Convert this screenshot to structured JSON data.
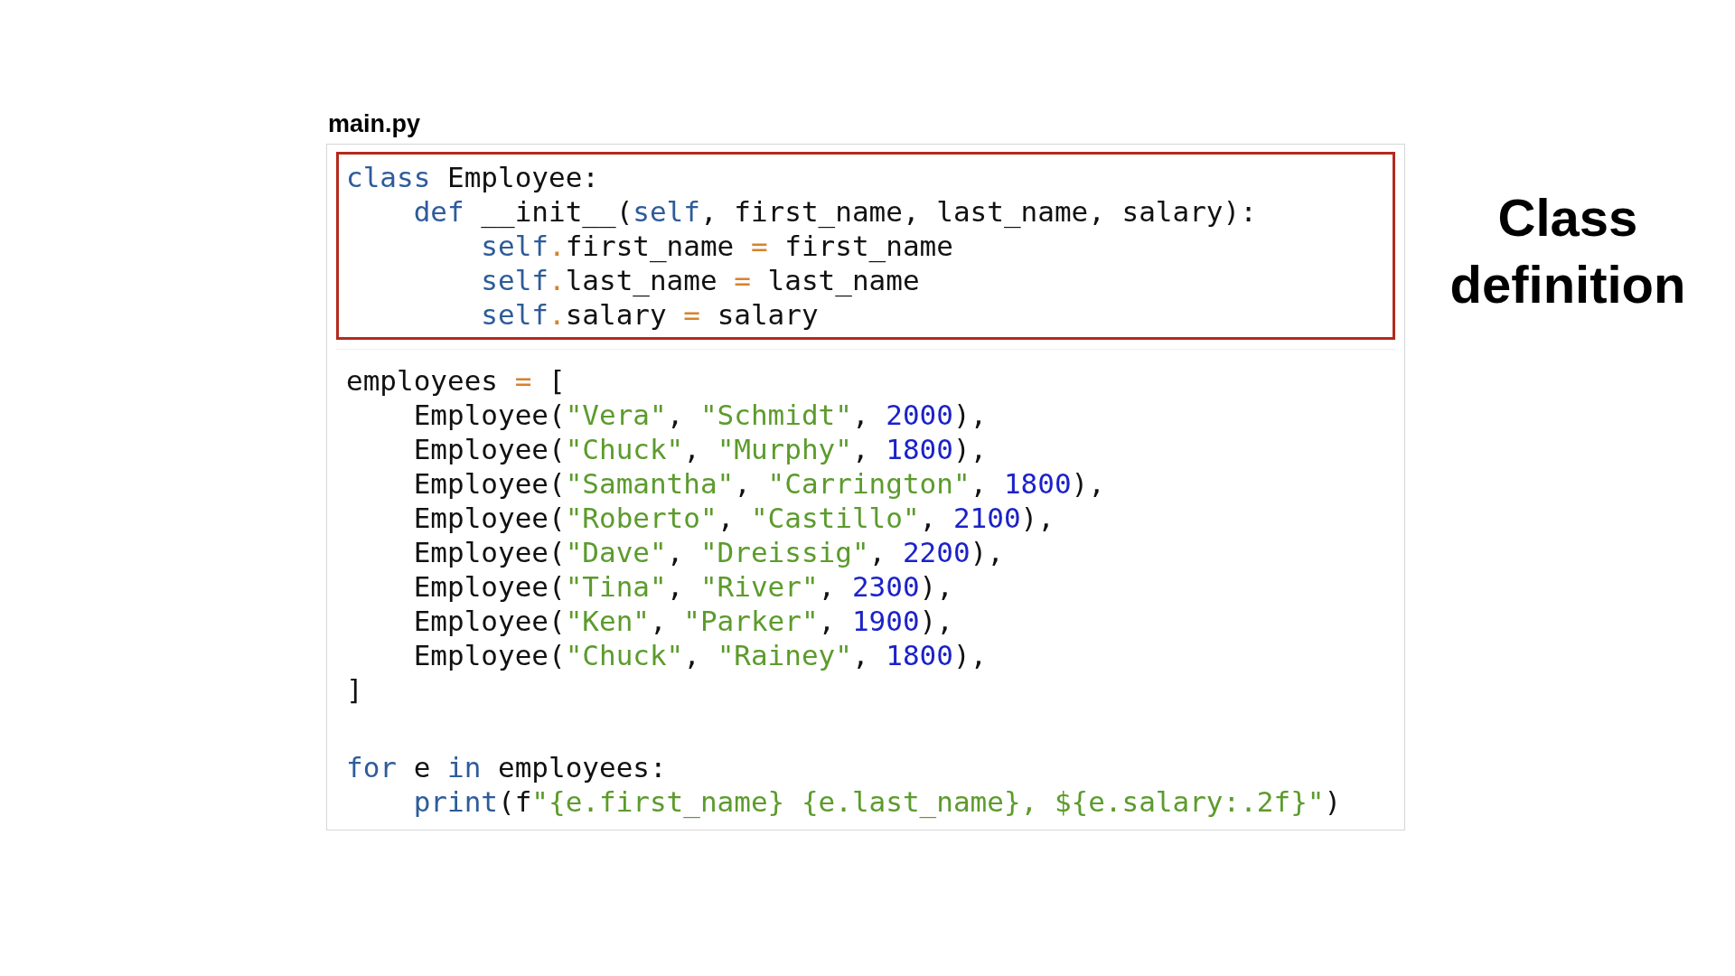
{
  "file": {
    "name": "main.py"
  },
  "code_blocks": [
    {
      "kind": "highlighted",
      "lines": [
        {
          "tokens": [
            {
              "kind": "keyword",
              "text": "class"
            },
            {
              "kind": "plain",
              "text": " Employee:"
            }
          ]
        },
        {
          "tokens": [
            {
              "kind": "keyword",
              "text": "    def"
            },
            {
              "kind": "plain",
              "text": " __init__("
            },
            {
              "kind": "keyword",
              "text": "self"
            },
            {
              "kind": "plain",
              "text": ", first_name, last_name, salary):"
            }
          ]
        },
        {
          "tokens": [
            {
              "kind": "keyword",
              "text": "        self"
            },
            {
              "kind": "operator",
              "text": "."
            },
            {
              "kind": "plain",
              "text": "first_name "
            },
            {
              "kind": "operator",
              "text": "="
            },
            {
              "kind": "plain",
              "text": " first_name"
            }
          ]
        },
        {
          "tokens": [
            {
              "kind": "keyword",
              "text": "        self"
            },
            {
              "kind": "operator",
              "text": "."
            },
            {
              "kind": "plain",
              "text": "last_name "
            },
            {
              "kind": "operator",
              "text": "="
            },
            {
              "kind": "plain",
              "text": " last_name"
            }
          ]
        },
        {
          "tokens": [
            {
              "kind": "keyword",
              "text": "        self"
            },
            {
              "kind": "operator",
              "text": "."
            },
            {
              "kind": "plain",
              "text": "salary "
            },
            {
              "kind": "operator",
              "text": "="
            },
            {
              "kind": "plain",
              "text": " salary"
            }
          ]
        }
      ]
    },
    {
      "kind": "plain",
      "lines": [
        {
          "tokens": [
            {
              "kind": "plain",
              "text": "employees "
            },
            {
              "kind": "operator",
              "text": "="
            },
            {
              "kind": "plain",
              "text": " ["
            }
          ]
        },
        {
          "tokens": [
            {
              "kind": "plain",
              "text": "    Employee("
            },
            {
              "kind": "string",
              "text": "\"Vera\""
            },
            {
              "kind": "plain",
              "text": ", "
            },
            {
              "kind": "string",
              "text": "\"Schmidt\""
            },
            {
              "kind": "plain",
              "text": ", "
            },
            {
              "kind": "number",
              "text": "2000"
            },
            {
              "kind": "plain",
              "text": "),"
            }
          ]
        },
        {
          "tokens": [
            {
              "kind": "plain",
              "text": "    Employee("
            },
            {
              "kind": "string",
              "text": "\"Chuck\""
            },
            {
              "kind": "plain",
              "text": ", "
            },
            {
              "kind": "string",
              "text": "\"Murphy\""
            },
            {
              "kind": "plain",
              "text": ", "
            },
            {
              "kind": "number",
              "text": "1800"
            },
            {
              "kind": "plain",
              "text": "),"
            }
          ]
        },
        {
          "tokens": [
            {
              "kind": "plain",
              "text": "    Employee("
            },
            {
              "kind": "string",
              "text": "\"Samantha\""
            },
            {
              "kind": "plain",
              "text": ", "
            },
            {
              "kind": "string",
              "text": "\"Carrington\""
            },
            {
              "kind": "plain",
              "text": ", "
            },
            {
              "kind": "number",
              "text": "1800"
            },
            {
              "kind": "plain",
              "text": "),"
            }
          ]
        },
        {
          "tokens": [
            {
              "kind": "plain",
              "text": "    Employee("
            },
            {
              "kind": "string",
              "text": "\"Roberto\""
            },
            {
              "kind": "plain",
              "text": ", "
            },
            {
              "kind": "string",
              "text": "\"Castillo\""
            },
            {
              "kind": "plain",
              "text": ", "
            },
            {
              "kind": "number",
              "text": "2100"
            },
            {
              "kind": "plain",
              "text": "),"
            }
          ]
        },
        {
          "tokens": [
            {
              "kind": "plain",
              "text": "    Employee("
            },
            {
              "kind": "string",
              "text": "\"Dave\""
            },
            {
              "kind": "plain",
              "text": ", "
            },
            {
              "kind": "string",
              "text": "\"Dreissig\""
            },
            {
              "kind": "plain",
              "text": ", "
            },
            {
              "kind": "number",
              "text": "2200"
            },
            {
              "kind": "plain",
              "text": "),"
            }
          ]
        },
        {
          "tokens": [
            {
              "kind": "plain",
              "text": "    Employee("
            },
            {
              "kind": "string",
              "text": "\"Tina\""
            },
            {
              "kind": "plain",
              "text": ", "
            },
            {
              "kind": "string",
              "text": "\"River\""
            },
            {
              "kind": "plain",
              "text": ", "
            },
            {
              "kind": "number",
              "text": "2300"
            },
            {
              "kind": "plain",
              "text": "),"
            }
          ]
        },
        {
          "tokens": [
            {
              "kind": "plain",
              "text": "    Employee("
            },
            {
              "kind": "string",
              "text": "\"Ken\""
            },
            {
              "kind": "plain",
              "text": ", "
            },
            {
              "kind": "string",
              "text": "\"Parker\""
            },
            {
              "kind": "plain",
              "text": ", "
            },
            {
              "kind": "number",
              "text": "1900"
            },
            {
              "kind": "plain",
              "text": "),"
            }
          ]
        },
        {
          "tokens": [
            {
              "kind": "plain",
              "text": "    Employee("
            },
            {
              "kind": "string",
              "text": "\"Chuck\""
            },
            {
              "kind": "plain",
              "text": ", "
            },
            {
              "kind": "string",
              "text": "\"Rainey\""
            },
            {
              "kind": "plain",
              "text": ", "
            },
            {
              "kind": "number",
              "text": "1800"
            },
            {
              "kind": "plain",
              "text": "),"
            }
          ]
        },
        {
          "tokens": [
            {
              "kind": "plain",
              "text": "]"
            }
          ]
        }
      ]
    },
    {
      "kind": "plain",
      "lines": [
        {
          "tokens": [
            {
              "kind": "keyword",
              "text": "for"
            },
            {
              "kind": "plain",
              "text": " e "
            },
            {
              "kind": "keyword",
              "text": "in"
            },
            {
              "kind": "plain",
              "text": " employees:"
            }
          ]
        },
        {
          "tokens": [
            {
              "kind": "keyword",
              "text": "    print"
            },
            {
              "kind": "plain",
              "text": "(f"
            },
            {
              "kind": "string",
              "text": "\"{e.first_name} {e.last_name}, ${e.salary:.2f}\""
            },
            {
              "kind": "plain",
              "text": ")"
            }
          ]
        }
      ]
    }
  ],
  "callout": {
    "text": "Class definition"
  }
}
